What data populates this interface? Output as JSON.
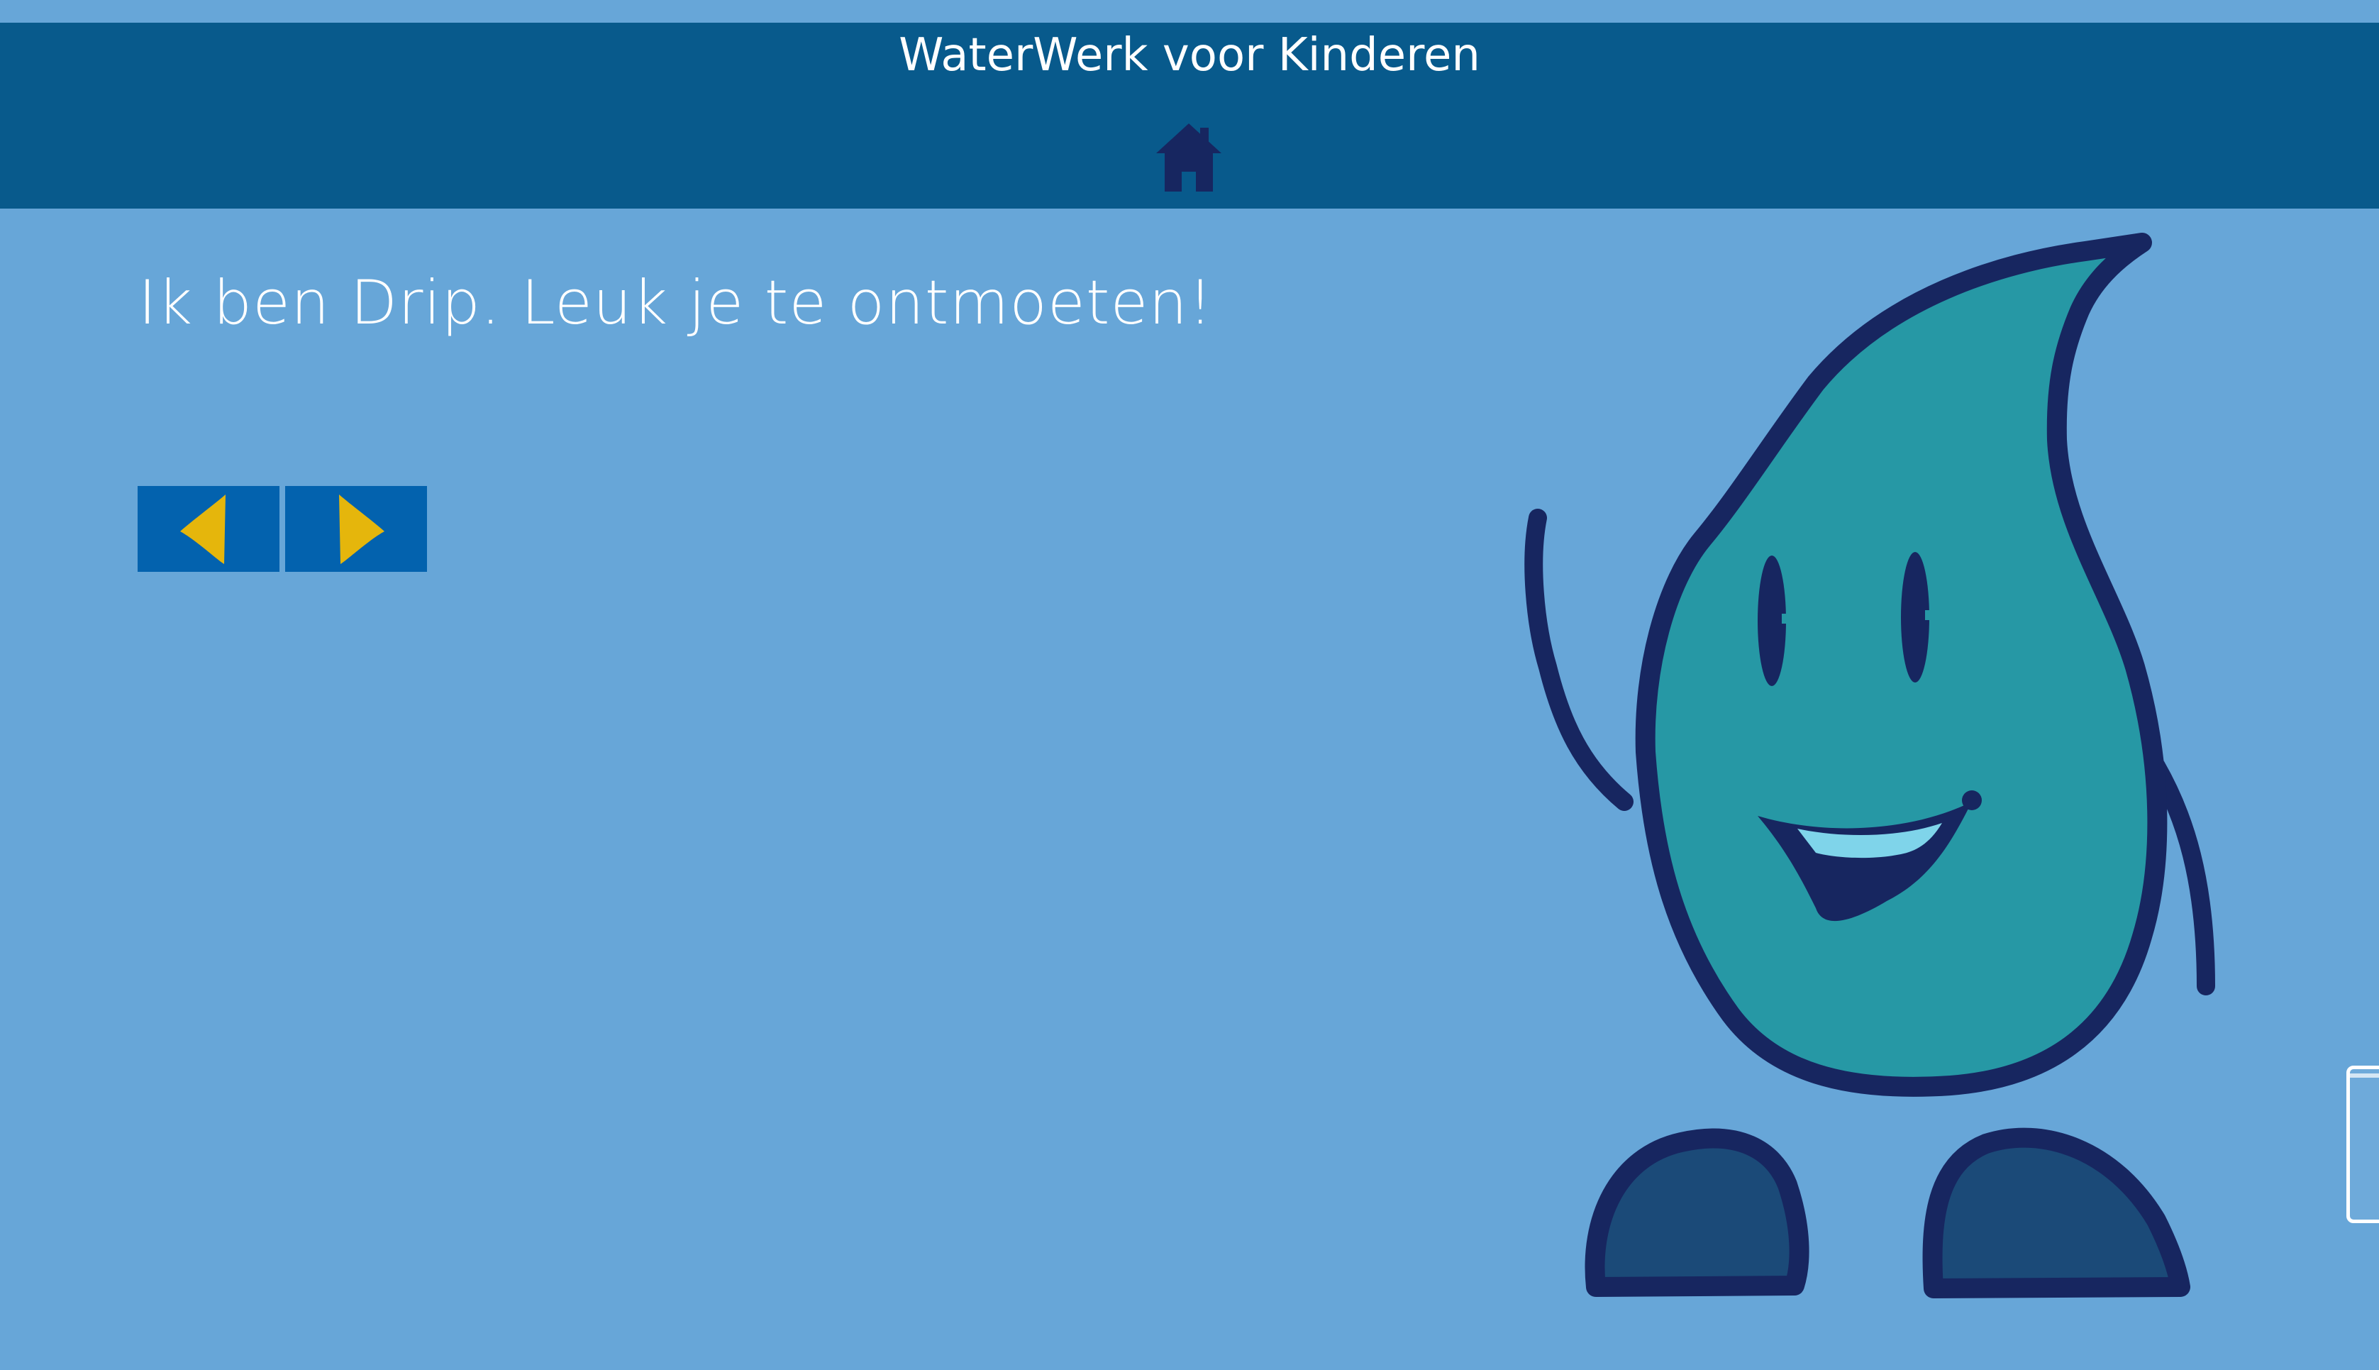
{
  "header": {
    "title": "WaterWerk voor Kinderen",
    "home_icon": "home-icon"
  },
  "main": {
    "greeting": "Ik ben Drip. Leuk je te ontmoeten!",
    "prev_icon": "arrow-left-icon",
    "next_icon": "arrow-right-icon"
  },
  "colors": {
    "background": "#67a6d8",
    "header": "#085a8c",
    "nav_button": "#0362ae",
    "arrow": "#e5b60c",
    "mascot_body": "#2698a5",
    "mascot_outline": "#172660",
    "mascot_feet": "#1b4a78"
  }
}
